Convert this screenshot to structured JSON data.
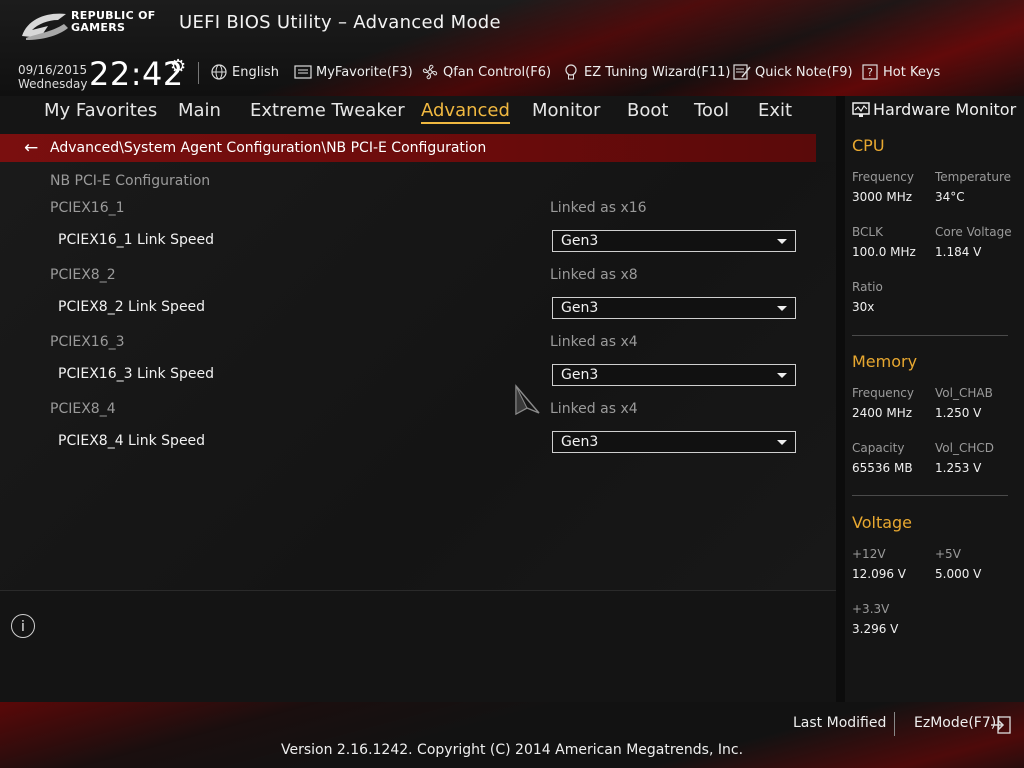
{
  "header": {
    "brand_line1": "REPUBLIC OF",
    "brand_line2": "GAMERS",
    "title": "UEFI BIOS Utility – Advanced Mode",
    "date": "09/16/2015",
    "weekday": "Wednesday",
    "time": "22:42"
  },
  "toolbar": {
    "language": "English",
    "myfavorite": "MyFavorite(F3)",
    "qfan": "Qfan Control(F6)",
    "ez_tuning": "EZ Tuning Wizard(F11)",
    "quick_note": "Quick Note(F9)",
    "hot_keys": "Hot Keys"
  },
  "menu": {
    "items": [
      "My Favorites",
      "Main",
      "Extreme Tweaker",
      "Advanced",
      "Monitor",
      "Boot",
      "Tool",
      "Exit"
    ],
    "active": "Advanced"
  },
  "breadcrumb": "Advanced\\System Agent Configuration\\NB PCI-E Configuration",
  "section_title": "NB PCI-E Configuration",
  "slots": [
    {
      "name": "PCIEX16_1",
      "status": "Linked as x16",
      "setting": "PCIEX16_1 Link Speed",
      "value": "Gen3"
    },
    {
      "name": "PCIEX8_2",
      "status": "Linked as x8",
      "setting": "PCIEX8_2 Link Speed",
      "value": "Gen3"
    },
    {
      "name": "PCIEX16_3",
      "status": "Linked as x4",
      "setting": "PCIEX16_3 Link Speed",
      "value": "Gen3"
    },
    {
      "name": "PCIEX8_4",
      "status": "Linked as x4",
      "setting": "PCIEX8_4 Link Speed",
      "value": "Gen3"
    }
  ],
  "hw_monitor": {
    "title": "Hardware Monitor",
    "cpu": {
      "heading": "CPU",
      "frequency_label": "Frequency",
      "frequency": "3000 MHz",
      "temperature_label": "Temperature",
      "temperature": "34°C",
      "bclk_label": "BCLK",
      "bclk": "100.0 MHz",
      "core_voltage_label": "Core Voltage",
      "core_voltage": "1.184 V",
      "ratio_label": "Ratio",
      "ratio": "30x"
    },
    "memory": {
      "heading": "Memory",
      "frequency_label": "Frequency",
      "frequency": "2400 MHz",
      "vol_chab_label": "Vol_CHAB",
      "vol_chab": "1.250 V",
      "capacity_label": "Capacity",
      "capacity": "65536 MB",
      "vol_chcd_label": "Vol_CHCD",
      "vol_chcd": "1.253 V"
    },
    "voltage": {
      "heading": "Voltage",
      "v12_label": "+12V",
      "v12": "12.096 V",
      "v5_label": "+5V",
      "v5": "5.000 V",
      "v33_label": "+3.3V",
      "v33": "3.296 V"
    }
  },
  "footer": {
    "last_modified": "Last Modified",
    "ezmode": "EzMode(F7)|",
    "version": "Version 2.16.1242. Copyright (C) 2014 American Megatrends, Inc."
  },
  "colors": {
    "accent": "#f0b840",
    "breadcrumb_bg": "#7a0f0f",
    "hw_heading": "#e8a830"
  }
}
